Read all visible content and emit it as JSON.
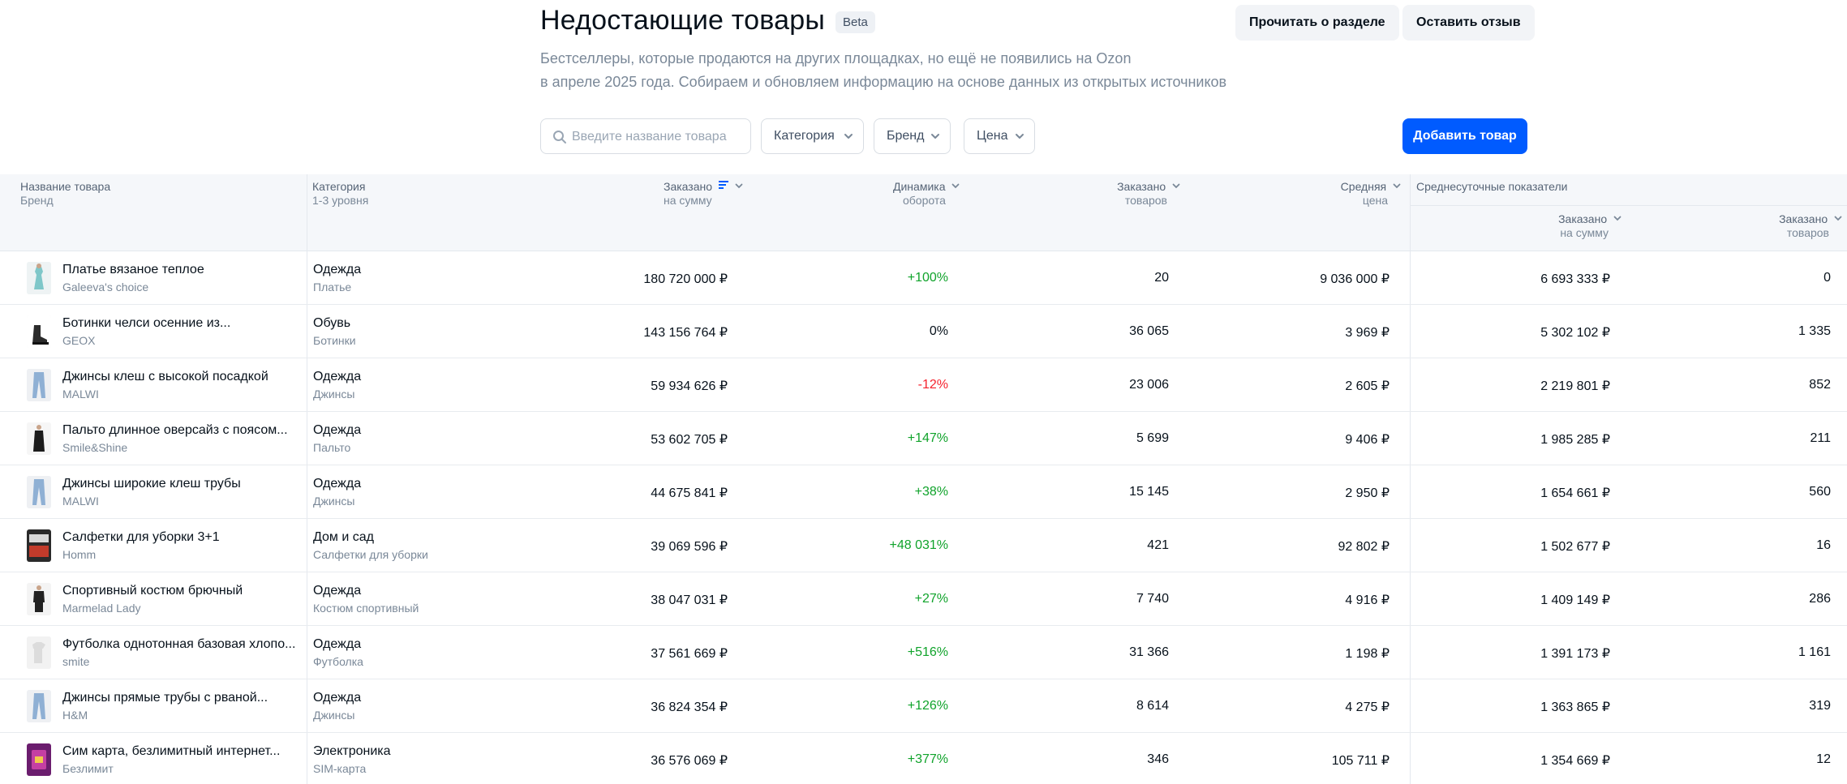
{
  "header": {
    "title": "Недостающие товары",
    "badge": "Beta",
    "read_button": "Прочитать о разделе",
    "feedback_button": "Оставить отзыв",
    "description_line1": "Бестселлеры, которые продаются на других площадках, но ещё не появились на Ozon",
    "description_line2": "в апреле 2025 года. Собираем и обновляем информацию на основе данных из открытых источников"
  },
  "filters": {
    "search_placeholder": "Введите название товара",
    "search_value": "",
    "category": "Категория",
    "brand": "Бренд",
    "price": "Цена",
    "add_button": "Добавить товар"
  },
  "colors": {
    "accent": "#005bff",
    "positive": "#10a32b",
    "negative": "#f5222d",
    "header_bg": "#f5f7fa"
  },
  "table": {
    "headers": {
      "name": "Название товара",
      "name_sub": "Бренд",
      "category": "Категория",
      "category_sub": "1-3 уровня",
      "sum": "Заказано",
      "sum_sub": "на сумму",
      "dynamics": "Динамика",
      "dynamics_sub": "оборота",
      "count": "Заказано",
      "count_sub": "товаров",
      "price": "Средняя",
      "price_sub": "цена",
      "avg_group": "Среднесуточные показатели",
      "avg_sum": "Заказано",
      "avg_sum_sub": "на сумму",
      "avg_count": "Заказано",
      "avg_count_sub": "товаров"
    },
    "rows": [
      {
        "name": "Платье вязаное теплое",
        "brand": "Galeeva's choice",
        "cat1": "Одежда",
        "cat2": "Платье",
        "sum": "180 720 000 ₽",
        "dyn": "+100%",
        "dyn_sign": "pos",
        "count": "20",
        "price": "9 036 000 ₽",
        "avg_sum": "6 693 333 ₽",
        "avg_count": "0",
        "thumb_icon": "dress-thumb"
      },
      {
        "name": "Ботинки челси осенние из...",
        "brand": "GEOX",
        "cat1": "Обувь",
        "cat2": "Ботинки",
        "sum": "143 156 764 ₽",
        "dyn": "0%",
        "dyn_sign": "zero",
        "count": "36 065",
        "price": "3 969 ₽",
        "avg_sum": "5 302 102 ₽",
        "avg_count": "1 335",
        "thumb_icon": "boots-thumb"
      },
      {
        "name": "Джинсы клеш с высокой посадкой",
        "brand": "MALWI",
        "cat1": "Одежда",
        "cat2": "Джинсы",
        "sum": "59 934 626 ₽",
        "dyn": "-12%",
        "dyn_sign": "neg",
        "count": "23 006",
        "price": "2 605 ₽",
        "avg_sum": "2 219 801 ₽",
        "avg_count": "852",
        "thumb_icon": "jeans-thumb"
      },
      {
        "name": "Пальто длинное оверсайз с поясом...",
        "brand": "Smile&Shine",
        "cat1": "Одежда",
        "cat2": "Пальто",
        "sum": "53 602 705 ₽",
        "dyn": "+147%",
        "dyn_sign": "pos",
        "count": "5 699",
        "price": "9 406 ₽",
        "avg_sum": "1 985 285 ₽",
        "avg_count": "211",
        "thumb_icon": "coat-thumb"
      },
      {
        "name": "Джинсы широкие клеш трубы",
        "brand": "MALWI",
        "cat1": "Одежда",
        "cat2": "Джинсы",
        "sum": "44 675 841 ₽",
        "dyn": "+38%",
        "dyn_sign": "pos",
        "count": "15 145",
        "price": "2 950 ₽",
        "avg_sum": "1 654 661 ₽",
        "avg_count": "560",
        "thumb_icon": "jeans-thumb"
      },
      {
        "name": "Салфетки для уборки 3+1",
        "brand": "Homm",
        "cat1": "Дом и сад",
        "cat2": "Салфетки для уборки",
        "sum": "39 069 596 ₽",
        "dyn": "+48 031%",
        "dyn_sign": "pos",
        "count": "421",
        "price": "92 802 ₽",
        "avg_sum": "1 502 677 ₽",
        "avg_count": "16",
        "thumb_icon": "wipes-thumb"
      },
      {
        "name": "Спортивный костюм брючный",
        "brand": "Marmelad Lady",
        "cat1": "Одежда",
        "cat2": "Костюм спортивный",
        "sum": "38 047 031 ₽",
        "dyn": "+27%",
        "dyn_sign": "pos",
        "count": "7 740",
        "price": "4 916 ₽",
        "avg_sum": "1 409 149 ₽",
        "avg_count": "286",
        "thumb_icon": "tracksuit-thumb"
      },
      {
        "name": "Футболка однотонная базовая хлопо...",
        "brand": "smite",
        "cat1": "Одежда",
        "cat2": "Футболка",
        "sum": "37 561 669 ₽",
        "dyn": "+516%",
        "dyn_sign": "pos",
        "count": "31 366",
        "price": "1 198 ₽",
        "avg_sum": "1 391 173 ₽",
        "avg_count": "1 161",
        "thumb_icon": "tshirt-thumb"
      },
      {
        "name": "Джинсы прямые трубы с рваной...",
        "brand": "H&M",
        "cat1": "Одежда",
        "cat2": "Джинсы",
        "sum": "36 824 354 ₽",
        "dyn": "+126%",
        "dyn_sign": "pos",
        "count": "8 614",
        "price": "4 275 ₽",
        "avg_sum": "1 363 865 ₽",
        "avg_count": "319",
        "thumb_icon": "jeans-thumb"
      },
      {
        "name": "Сим карта, безлимитный интернет...",
        "brand": "Безлимит",
        "cat1": "Электроника",
        "cat2": "SIM-карта",
        "sum": "36 576 069 ₽",
        "dyn": "+377%",
        "dyn_sign": "pos",
        "count": "346",
        "price": "105 711 ₽",
        "avg_sum": "1 354 669 ₽",
        "avg_count": "12",
        "thumb_icon": "simcard-thumb"
      }
    ]
  }
}
